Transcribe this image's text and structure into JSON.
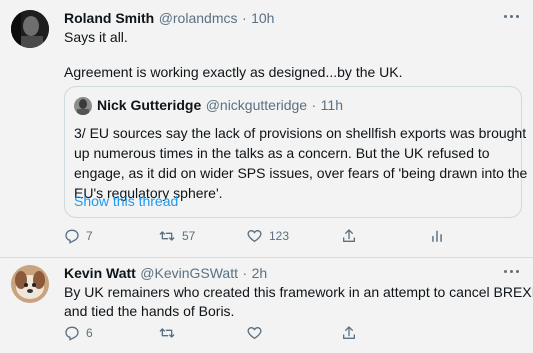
{
  "tweets": [
    {
      "author": "Roland Smith",
      "handle": "@rolandmcs",
      "sep": "·",
      "time": "10h",
      "line1": "Says it all.",
      "line2": "Agreement is working exactly as designed...by the UK.",
      "quote": {
        "author": "Nick Gutteridge",
        "handle": "@nickgutteridge",
        "sep": "·",
        "time": "11h",
        "lines": [
          "3/ EU sources say the lack of provisions on shellfish exports was brought",
          "up numerous times in the talks as a concern. But the UK refused to",
          "engage, as it did on wider SPS issues, over fears of 'being drawn into the",
          "EU's regulatory sphere'."
        ],
        "show_thread": "Show this thread"
      },
      "replies": "7",
      "retweets": "57",
      "likes": "123"
    },
    {
      "author": "Kevin Watt",
      "handle": "@KevinGSWatt",
      "sep": "·",
      "time": "2h",
      "lines": [
        "By UK remainers who created this framework in an attempt to cancel BREXIT",
        "and tied the hands of Boris."
      ],
      "replies": "6"
    }
  ],
  "icons": {
    "more": "more-horizontal-icon",
    "reply": "reply-icon",
    "retweet": "retweet-icon",
    "like": "heart-icon",
    "share": "share-icon",
    "analytics": "analytics-icon"
  },
  "colors": {
    "link": "#1d9bf0",
    "secondary_text": "#5b7083",
    "background": "#f2f3f2"
  }
}
